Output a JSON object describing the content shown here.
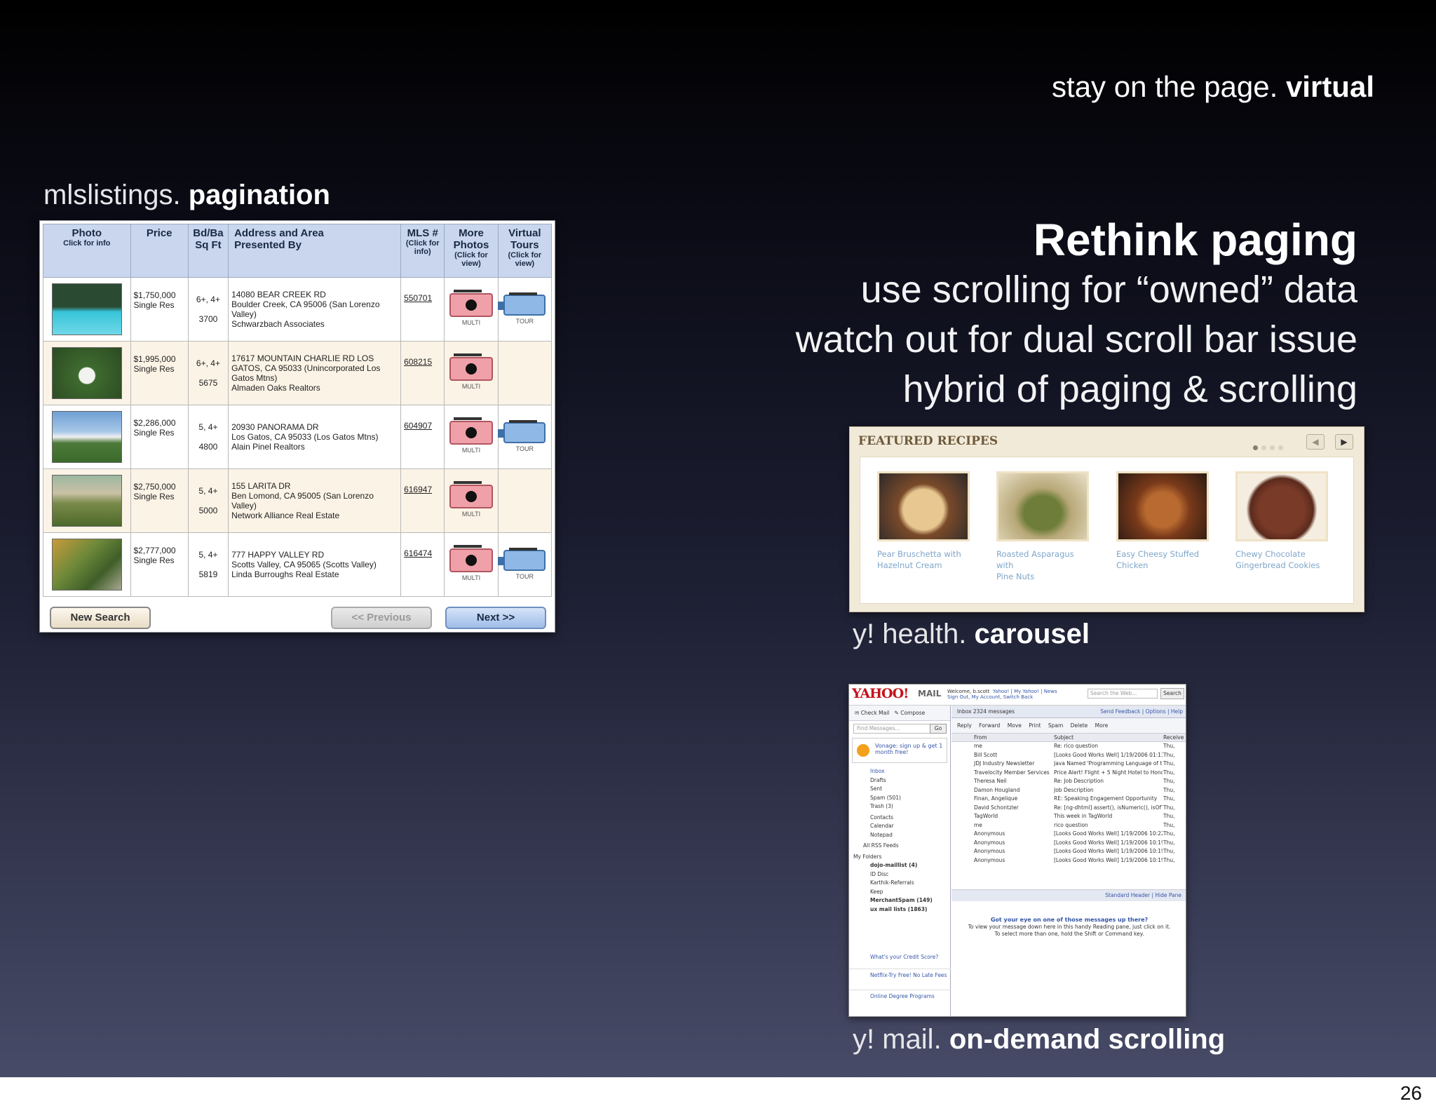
{
  "slide": {
    "title_plain": "stay on the page.",
    "title_bold": "virtual",
    "heading": "Rethink paging",
    "bullets": [
      "use scrolling for “owned” data",
      "watch out for dual scroll bar issue",
      "hybrid of paging & scrolling"
    ],
    "captions": {
      "mls_plain": "mlslistings.",
      "mls_bold": "pagination",
      "carousel_plain": "y! health.",
      "carousel_bold": "carousel",
      "mail_plain": "y! mail.",
      "mail_bold": "on-demand scrolling"
    },
    "page_number": "26"
  },
  "mls": {
    "headers": {
      "photo": "Photo",
      "photo_sub": "Click for info",
      "price": "Price",
      "bdba": "Bd/Ba",
      "sqft": "Sq Ft",
      "address": "Address and Area",
      "presented": "Presented By",
      "mls": "MLS #",
      "mls_sub": "(Click for info)",
      "more_photos": "More Photos",
      "more_photos_sub": "(Click for view)",
      "tours": "Virtual Tours",
      "tours_sub": "(Click for view)"
    },
    "rows": [
      {
        "price": "$1,750,000",
        "type": "Single Res",
        "bdba": "6+, 4+",
        "sqft": "3700",
        "address": "14080 BEAR CREEK RD",
        "area": "Boulder Creek, CA 95006  (San Lorenzo Valley)",
        "agent": "Schwarzbach Associates",
        "mls": "550701",
        "multi": "MULTI",
        "tour": "TOUR"
      },
      {
        "price": "$1,995,000",
        "type": "Single Res",
        "bdba": "6+, 4+",
        "sqft": "5675",
        "address": "17617 MOUNTAIN CHARLIE RD LOS",
        "area": "GATOS, CA 95033  (Unincorporated Los Gatos Mtns)",
        "agent": "Almaden Oaks Realtors",
        "mls": "608215",
        "multi": "MULTI",
        "tour": ""
      },
      {
        "price": "$2,286,000",
        "type": "Single Res",
        "bdba": "5, 4+",
        "sqft": "4800",
        "address": "20930 PANORAMA DR",
        "area": "Los Gatos, CA 95033  (Los Gatos Mtns)",
        "agent": "Alain Pinel Realtors",
        "mls": "604907",
        "multi": "MULTI",
        "tour": "TOUR"
      },
      {
        "price": "$2,750,000",
        "type": "Single Res",
        "bdba": "5, 4+",
        "sqft": "5000",
        "address": "155 LARITA DR",
        "area": "Ben Lomond, CA 95005  (San Lorenzo Valley)",
        "agent": "Network Alliance Real Estate",
        "mls": "616947",
        "multi": "MULTI",
        "tour": ""
      },
      {
        "price": "$2,777,000",
        "type": "Single Res",
        "bdba": "5, 4+",
        "sqft": "5819",
        "address": "777 HAPPY VALLEY RD",
        "area": "Scotts Valley, CA 95065  (Scotts Valley)",
        "agent": "Linda Burroughs Real Estate",
        "mls": "616474",
        "multi": "MULTI",
        "tour": "TOUR"
      }
    ],
    "buttons": {
      "new_search": "New Search",
      "previous": "<< Previous",
      "next": "Next >>"
    }
  },
  "recipes": {
    "title": "FEATURED RECIPES",
    "items": [
      {
        "line1": "Pear Bruschetta with",
        "line2": "Hazelnut Cream",
        "color": "#c8a67a"
      },
      {
        "line1": "Roasted Asparagus with",
        "line2": "Pine Nuts",
        "color": "#8c9a5a"
      },
      {
        "line1": "Easy Cheesy Stuffed",
        "line2": "Chicken",
        "color": "#9a5a2e"
      },
      {
        "line1": "Chewy Chocolate",
        "line2": "Gingerbread Cookies",
        "color": "#6b3a2a"
      }
    ]
  },
  "ymail": {
    "logo": "YAHOO!",
    "mail": "MAIL",
    "welcome": "Welcome, b.scott",
    "links": "Yahoo! | My Yahoo! | News",
    "signout": "Sign Out, My Account, Switch Back",
    "search_placeholder": "Search the Web...",
    "search_btn": "Search",
    "check_mail": "Check Mail",
    "compose": "Compose",
    "find_placeholder": "Find Messages...",
    "go": "Go",
    "vonage": "Vonage: sign up & get 1 month free!",
    "folders": [
      "Inbox",
      "Drafts",
      "Sent",
      "Spam (501)",
      "Trash (3)",
      "Contacts",
      "Calendar",
      "Notepad",
      "All RSS Feeds",
      "My Folders",
      "dojo-maillist (4)",
      "ID Disc",
      "Karthik-Referrals",
      "Keep",
      "MerchantSpam (149)",
      "ux mail lists (1863)"
    ],
    "ads": [
      "What's your Credit Score?",
      "Netflix-Try Free! No Late Fees",
      "Online Degree Programs"
    ],
    "inbox_tab": "Inbox  2324 messages",
    "right_links": "Send Feedback | Options | Help",
    "actions": "Reply Forward Move Print Spam Delete More",
    "col_from": "From",
    "col_subject": "Subject",
    "col_received": "Receive",
    "messages": [
      {
        "from": "me",
        "subject": "Re: rico question",
        "recv": "Thu,"
      },
      {
        "from": "Bill Scott",
        "subject": "[Looks Good Works Well] 1/19/2006 01:13:",
        "recv": "Thu,"
      },
      {
        "from": "JDJ Industry Newsletter",
        "subject": "Java Named 'Programming Language of th",
        "recv": "Thu,"
      },
      {
        "from": "Travelocity Member Services",
        "subject": "Price Alert! Flight + 5 Night Hotel to Honol",
        "recv": "Thu,"
      },
      {
        "from": "Theresa Neil",
        "subject": "Re: Job Description",
        "recv": "Thu,"
      },
      {
        "from": "Damon Hougland",
        "subject": "Job Description",
        "recv": "Thu,"
      },
      {
        "from": "Finan, Angelique",
        "subject": "RE: Speaking Engagement Opportunity",
        "recv": "Thu,"
      },
      {
        "from": "David Schontzler",
        "subject": "Re: [ng-dhtml] assert(), isNumeric(), isOfT",
        "recv": "Thu,"
      },
      {
        "from": "TagWorld",
        "subject": "This week in TagWorld",
        "recv": "Thu,"
      },
      {
        "from": "me",
        "subject": "rico question",
        "recv": "Thu,"
      },
      {
        "from": "Anonymous",
        "subject": "[Looks Good Works Well] 1/19/2006 10:22:",
        "recv": "Thu,"
      },
      {
        "from": "Anonymous",
        "subject": "[Looks Good Works Well] 1/19/2006 10:19:",
        "recv": "Thu,"
      },
      {
        "from": "Anonymous",
        "subject": "[Looks Good Works Well] 1/19/2006 10:19:",
        "recv": "Thu,"
      },
      {
        "from": "Anonymous",
        "subject": "[Looks Good Works Well] 1/19/2006 10:19:",
        "recv": "Thu,"
      }
    ],
    "reading_bar": "Standard Header | Hide Pane",
    "reading_title": "Got your eye on one of those messages up there?",
    "reading_line1": "To view your message down here in this handy Reading pane, just click on it.",
    "reading_line2": "To select more than one, hold the Shift or Command key."
  }
}
